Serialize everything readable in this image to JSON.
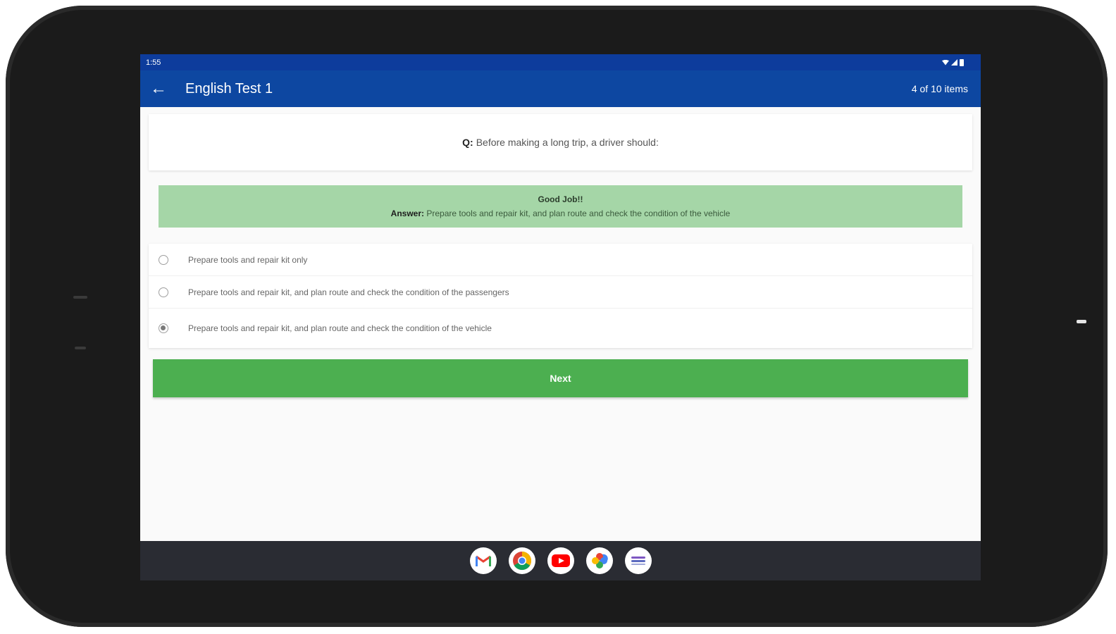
{
  "status_bar": {
    "time": "1:55"
  },
  "app_bar": {
    "back_icon": "arrow-left-icon",
    "title": "English Test 1",
    "count": "4 of 10 items"
  },
  "question": {
    "prefix": "Q:",
    "text": "Before making a long trip, a driver should:"
  },
  "feedback": {
    "heading": "Good Job!!",
    "answer_label": "Answer:",
    "answer_text": "Prepare tools and repair kit, and plan route and check the condition of the vehicle"
  },
  "options": [
    {
      "label": "Prepare tools and repair kit only",
      "selected": false
    },
    {
      "label": "Prepare tools and repair kit, and plan route and check the condition of the passengers",
      "selected": false
    },
    {
      "label": "Prepare tools and repair kit, and plan route and check the condition of the vehicle",
      "selected": true
    }
  ],
  "next_button": {
    "label": "Next"
  },
  "dock": [
    {
      "icon": "gmail-icon"
    },
    {
      "icon": "chrome-icon"
    },
    {
      "icon": "youtube-icon"
    },
    {
      "icon": "photos-icon"
    },
    {
      "icon": "app-drawer-icon"
    }
  ],
  "colors": {
    "status_bar": "#0d3c9c",
    "app_bar": "#0d47a1",
    "feedback_bg": "#a5d6a7",
    "next_button": "#4caf50"
  }
}
